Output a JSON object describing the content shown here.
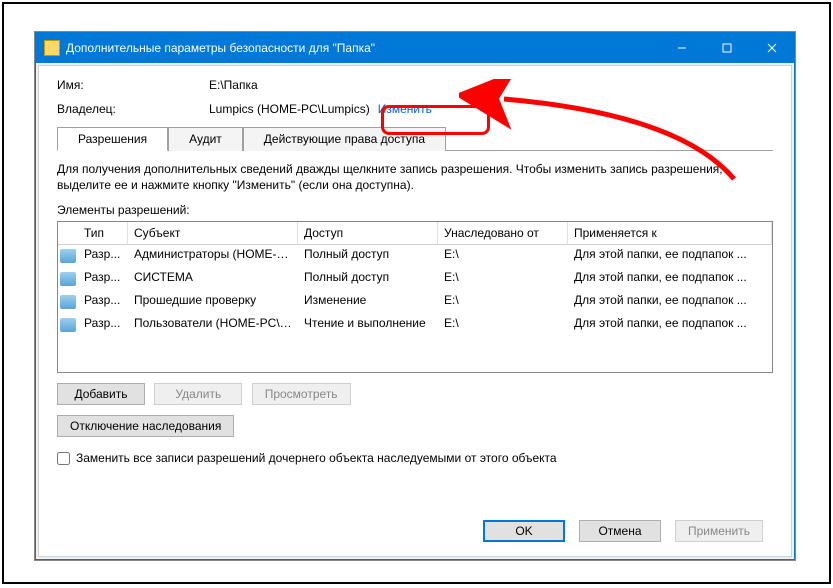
{
  "window_title": "Дополнительные параметры безопасности для \"Папка\"",
  "info": {
    "name_label": "Имя:",
    "name_value": "E:\\Папка",
    "owner_label": "Владелец:",
    "owner_value": "Lumpics (HOME-PC\\Lumpics)",
    "change_link": "Изменить"
  },
  "tabs": {
    "permissions": "Разрешения",
    "audit": "Аудит",
    "effective": "Действующие права доступа"
  },
  "hint": "Для получения дополнительных сведений дважды щелкните запись разрешения. Чтобы изменить запись разрешения, выделите ее и нажмите кнопку \"Изменить\" (если она доступна).",
  "elements_label": "Элементы разрешений:",
  "columns": {
    "type": "Тип",
    "subject": "Субъект",
    "access": "Доступ",
    "inherited": "Унаследовано от",
    "applies": "Применяется к"
  },
  "rows": [
    {
      "type": "Разр...",
      "subject": "Администраторы (HOME-PC...",
      "access": "Полный доступ",
      "inherited": "E:\\",
      "applies": "Для этой папки, ее подпапок ..."
    },
    {
      "type": "Разр...",
      "subject": "СИСТЕМА",
      "access": "Полный доступ",
      "inherited": "E:\\",
      "applies": "Для этой папки, ее подпапок ..."
    },
    {
      "type": "Разр...",
      "subject": "Прошедшие проверку",
      "access": "Изменение",
      "inherited": "E:\\",
      "applies": "Для этой папки, ее подпапок ..."
    },
    {
      "type": "Разр...",
      "subject": "Пользователи (HOME-PC\\П...",
      "access": "Чтение и выполнение",
      "inherited": "E:\\",
      "applies": "Для этой папки, ее подпапок ..."
    }
  ],
  "buttons": {
    "add": "Добавить",
    "remove": "Удалить",
    "view": "Просмотреть",
    "disable_inherit": "Отключение наследования",
    "replace_checkbox": "Заменить все записи разрешений дочернего объекта наследуемыми от этого объекта",
    "ok": "OK",
    "cancel": "Отмена",
    "apply": "Применить"
  }
}
